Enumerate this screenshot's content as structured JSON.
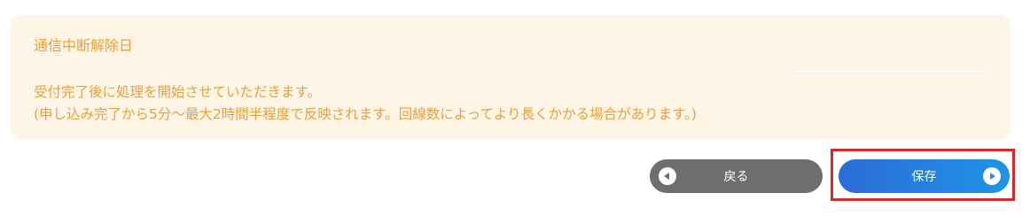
{
  "notice": {
    "title": "通信中断解除日",
    "line1": "受付完了後に処理を開始させていただきます。",
    "line2": "(申し込み完了から5分～最大2時間半程度で反映されます。回線数によってより長くかかる場合があります。)"
  },
  "actions": {
    "back_label": "戻る",
    "save_label": "保存"
  },
  "colors": {
    "notice_background": "#fff5e6",
    "notice_text": "#e8a13a",
    "back_button": "#6e6e6e",
    "save_button": "#1f94e5",
    "highlight": "#e0242c"
  },
  "icons": {
    "back": "arrow-left-circle-icon",
    "save": "arrow-right-circle-icon"
  }
}
